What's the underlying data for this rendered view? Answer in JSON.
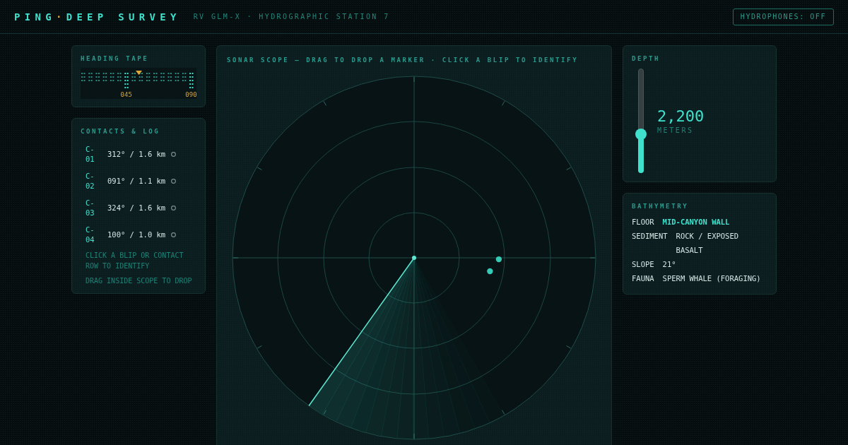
{
  "header": {
    "title": {
      "before": "PING",
      "separator": "·",
      "after": "DEEP SURVEY"
    },
    "subtitle": "RV GLM-X · HYDROGRAPHIC STATION 7",
    "toggle": {
      "label": "HYDROPHONES: OFF",
      "on": false
    }
  },
  "heading_tape": {
    "title": "HEADING TAPE",
    "labels": [
      "045",
      "090"
    ]
  },
  "contacts": {
    "title": "CONTACTS & LOG",
    "items": [
      {
        "id": "C-01",
        "reading": "312° / 1.6 km",
        "on_scope": false,
        "identified": false
      },
      {
        "id": "C-02",
        "reading": "091° / 1.1 km",
        "on_scope": true,
        "identified": false
      },
      {
        "id": "C-03",
        "reading": "324° / 1.6 km",
        "on_scope": false,
        "identified": false
      },
      {
        "id": "C-04",
        "reading": "100° / 1.0 km",
        "on_scope": true,
        "identified": false
      }
    ],
    "hints": [
      "CLICK A BLIP OR CONTACT ROW TO IDENTIFY",
      "DRAG INSIDE SCOPE TO DROP"
    ]
  },
  "sonar": {
    "title": "SONAR SCOPE — DRAG TO DROP A MARKER · CLICK A BLIP TO IDENTIFY"
  },
  "depth": {
    "title": "DEPTH",
    "value": "2,200",
    "unit": "METERS",
    "level": 0.37
  },
  "bathymetry": {
    "title": "BATHYMETRY",
    "rows": [
      {
        "label": "FLOOR",
        "value": "MID-CANYON WALL",
        "highlighted": true
      },
      {
        "label": "SEDIMENT",
        "value": "ROCK / EXPOSED BASALT",
        "highlighted": false
      },
      {
        "label": "SLOPE",
        "value": "21°",
        "highlighted": false
      },
      {
        "label": "FAUNA",
        "value": "SPERM WHALE (FORAGING)",
        "highlighted": false
      }
    ]
  }
}
